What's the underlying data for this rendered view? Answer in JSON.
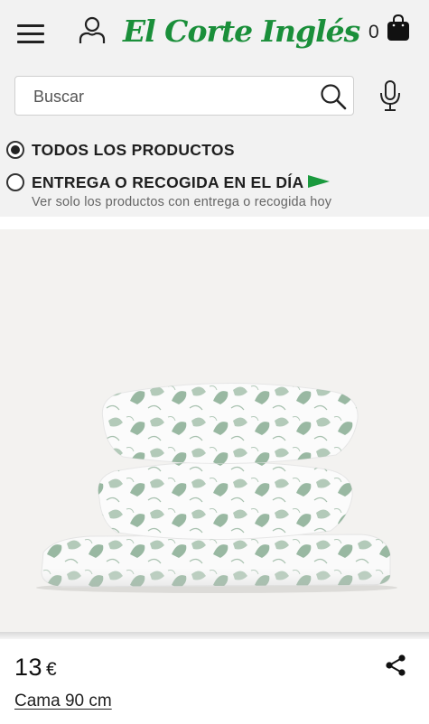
{
  "header": {
    "logo_text": "El Corte Inglés",
    "cart_count": "0",
    "icons": [
      "menu-icon",
      "user-icon",
      "shopping-bag-icon"
    ],
    "brand_color": "#1a8f3a"
  },
  "search": {
    "placeholder": "Buscar",
    "icons": [
      "search-icon",
      "microphone-icon"
    ]
  },
  "delivery_filter": {
    "options": [
      {
        "label": "TODOS LOS PRODUCTOS",
        "selected": true
      },
      {
        "label": "ENTREGA O RECOGIDA EN EL DÍA",
        "sublabel": "Ver solo los productos con entrega o recogida hoy",
        "selected": false,
        "icon": "green-flag-icon"
      }
    ]
  },
  "product": {
    "image_alt": "pillows-and-sheet-set-image",
    "pattern_color": "#7fa88a",
    "price_value": "13",
    "price_currency": "€",
    "size": "Cama 90 cm",
    "icons": [
      "share-icon"
    ]
  }
}
